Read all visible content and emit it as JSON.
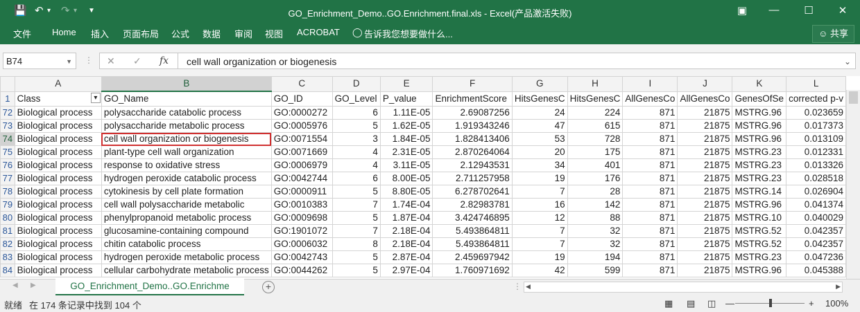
{
  "window": {
    "title": "GO_Enrichment_Demo..GO.Enrichment.final.xls - Excel(产品激活失败)"
  },
  "ribbon": {
    "tabs": [
      "文件",
      "Home",
      "插入",
      "页面布局",
      "公式",
      "数据",
      "审阅",
      "视图",
      "ACROBAT"
    ],
    "tell_me": "告诉我您想要做什么...",
    "share": "共享"
  },
  "formula_bar": {
    "name_box": "B74",
    "formula": "cell wall organization or biogenesis"
  },
  "columns": [
    "A",
    "B",
    "C",
    "D",
    "E",
    "F",
    "G",
    "H",
    "I",
    "J",
    "K",
    "L"
  ],
  "header_row": {
    "row_num": "1",
    "cells": [
      "Class",
      "GO_Name",
      "GO_ID",
      "GO_Level",
      "P_value",
      "EnrichmentScore",
      "HitsGenesC",
      "HitsGenesC",
      "AllGenesCo",
      "AllGenesCo",
      "GenesOfSe",
      "corrected p-v"
    ]
  },
  "rows": [
    {
      "n": "72",
      "cells": [
        "Biological process",
        "polysaccharide catabolic process",
        "GO:0000272",
        "6",
        "1.11E-05",
        "2.69087256",
        "24",
        "224",
        "871",
        "21875",
        "MSTRG.96",
        "0.023659"
      ]
    },
    {
      "n": "73",
      "cells": [
        "Biological process",
        "polysaccharide metabolic process",
        "GO:0005976",
        "5",
        "1.62E-05",
        "1.919343246",
        "47",
        "615",
        "871",
        "21875",
        "MSTRG.96",
        "0.017373"
      ]
    },
    {
      "n": "74",
      "cells": [
        "Biological process",
        "cell wall organization or biogenesis",
        "GO:0071554",
        "3",
        "1.84E-05",
        "1.828413406",
        "53",
        "728",
        "871",
        "21875",
        "MSTRG.96",
        "0.013109"
      ]
    },
    {
      "n": "75",
      "cells": [
        "Biological process",
        "plant-type cell wall organization",
        "GO:0071669",
        "4",
        "2.31E-05",
        "2.870264064",
        "20",
        "175",
        "871",
        "21875",
        "MSTRG.23",
        "0.012331"
      ]
    },
    {
      "n": "76",
      "cells": [
        "Biological process",
        "response to oxidative stress",
        "GO:0006979",
        "4",
        "3.11E-05",
        "2.12943531",
        "34",
        "401",
        "871",
        "21875",
        "MSTRG.23",
        "0.013326"
      ]
    },
    {
      "n": "77",
      "cells": [
        "Biological process",
        "hydrogen peroxide catabolic process",
        "GO:0042744",
        "6",
        "8.00E-05",
        "2.711257958",
        "19",
        "176",
        "871",
        "21875",
        "MSTRG.23",
        "0.028518"
      ]
    },
    {
      "n": "78",
      "cells": [
        "Biological process",
        "cytokinesis by cell plate formation",
        "GO:0000911",
        "5",
        "8.80E-05",
        "6.278702641",
        "7",
        "28",
        "871",
        "21875",
        "MSTRG.14",
        "0.026904"
      ]
    },
    {
      "n": "79",
      "cells": [
        "Biological process",
        "cell wall polysaccharide metabolic",
        "GO:0010383",
        "7",
        "1.74E-04",
        "2.82983781",
        "16",
        "142",
        "871",
        "21875",
        "MSTRG.96",
        "0.041374"
      ]
    },
    {
      "n": "80",
      "cells": [
        "Biological process",
        "phenylpropanoid metabolic process",
        "GO:0009698",
        "5",
        "1.87E-04",
        "3.424746895",
        "12",
        "88",
        "871",
        "21875",
        "MSTRG.10",
        "0.040029"
      ]
    },
    {
      "n": "81",
      "cells": [
        "Biological process",
        "glucosamine-containing compound",
        "GO:1901072",
        "7",
        "2.18E-04",
        "5.493864811",
        "7",
        "32",
        "871",
        "21875",
        "MSTRG.52",
        "0.042357"
      ]
    },
    {
      "n": "82",
      "cells": [
        "Biological process",
        "chitin catabolic process",
        "GO:0006032",
        "8",
        "2.18E-04",
        "5.493864811",
        "7",
        "32",
        "871",
        "21875",
        "MSTRG.52",
        "0.042357"
      ]
    },
    {
      "n": "83",
      "cells": [
        "Biological process",
        "hydrogen peroxide metabolic process",
        "GO:0042743",
        "5",
        "2.87E-04",
        "2.459697942",
        "19",
        "194",
        "871",
        "21875",
        "MSTRG.23",
        "0.047236"
      ]
    },
    {
      "n": "84",
      "cells": [
        "Biological process",
        "cellular carbohydrate metabolic process",
        "GO:0044262",
        "5",
        "2.97E-04",
        "1.760971692",
        "42",
        "599",
        "871",
        "21875",
        "MSTRG.96",
        "0.045388"
      ]
    }
  ],
  "selected": {
    "row": "74",
    "col": "B"
  },
  "sheet_tab": "GO_Enrichment_Demo..GO.Enrichme",
  "status": {
    "ready": "就绪",
    "found": "在 174 条记录中找到 104 个",
    "zoom": "100%"
  },
  "colors": {
    "accent": "#217346",
    "highlight": "#d03030"
  }
}
